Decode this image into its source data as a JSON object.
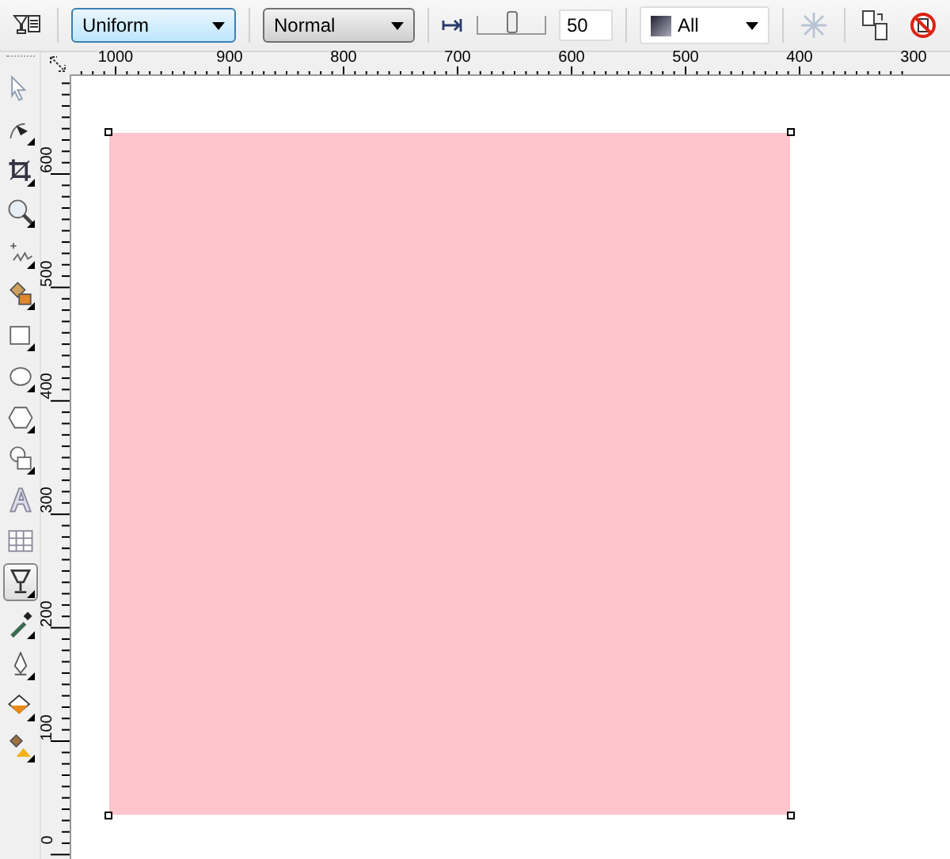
{
  "toolbar": {
    "fill_type": {
      "value": "Uniform",
      "focused": true
    },
    "operation": {
      "value": "Normal",
      "focused": false
    },
    "slider": {
      "level": 0.5
    },
    "amount": {
      "value": "50"
    },
    "target": {
      "value": "All"
    },
    "freeze": {
      "disabled": true
    }
  },
  "ruler_h": {
    "labels": [
      "1000",
      "900",
      "800",
      "700",
      "600",
      "500",
      "400",
      "300"
    ]
  },
  "ruler_v": {
    "labels": [
      "600",
      "500",
      "400",
      "300",
      "200",
      "100",
      "0"
    ]
  },
  "tools": [
    {
      "kind": "pick",
      "flyout": false,
      "selected": false
    },
    {
      "kind": "shape",
      "flyout": true,
      "selected": false
    },
    {
      "kind": "crop",
      "flyout": true,
      "selected": false
    },
    {
      "kind": "zoom",
      "flyout": true,
      "selected": false
    },
    {
      "kind": "freehand",
      "flyout": true,
      "selected": false
    },
    {
      "kind": "smartfill",
      "flyout": true,
      "selected": false
    },
    {
      "kind": "rectangle",
      "flyout": true,
      "selected": false
    },
    {
      "kind": "ellipse",
      "flyout": true,
      "selected": false
    },
    {
      "kind": "polygon",
      "flyout": true,
      "selected": false
    },
    {
      "kind": "shapes",
      "flyout": true,
      "selected": false
    },
    {
      "kind": "text",
      "flyout": false,
      "selected": false
    },
    {
      "kind": "table",
      "flyout": false,
      "selected": false
    },
    {
      "kind": "transparency",
      "flyout": true,
      "selected": true
    },
    {
      "kind": "eyedropper",
      "flyout": true,
      "selected": false
    },
    {
      "kind": "pen",
      "flyout": true,
      "selected": false
    },
    {
      "kind": "fill",
      "flyout": true,
      "selected": false
    },
    {
      "kind": "interactivefill",
      "flyout": true,
      "selected": false
    }
  ]
}
